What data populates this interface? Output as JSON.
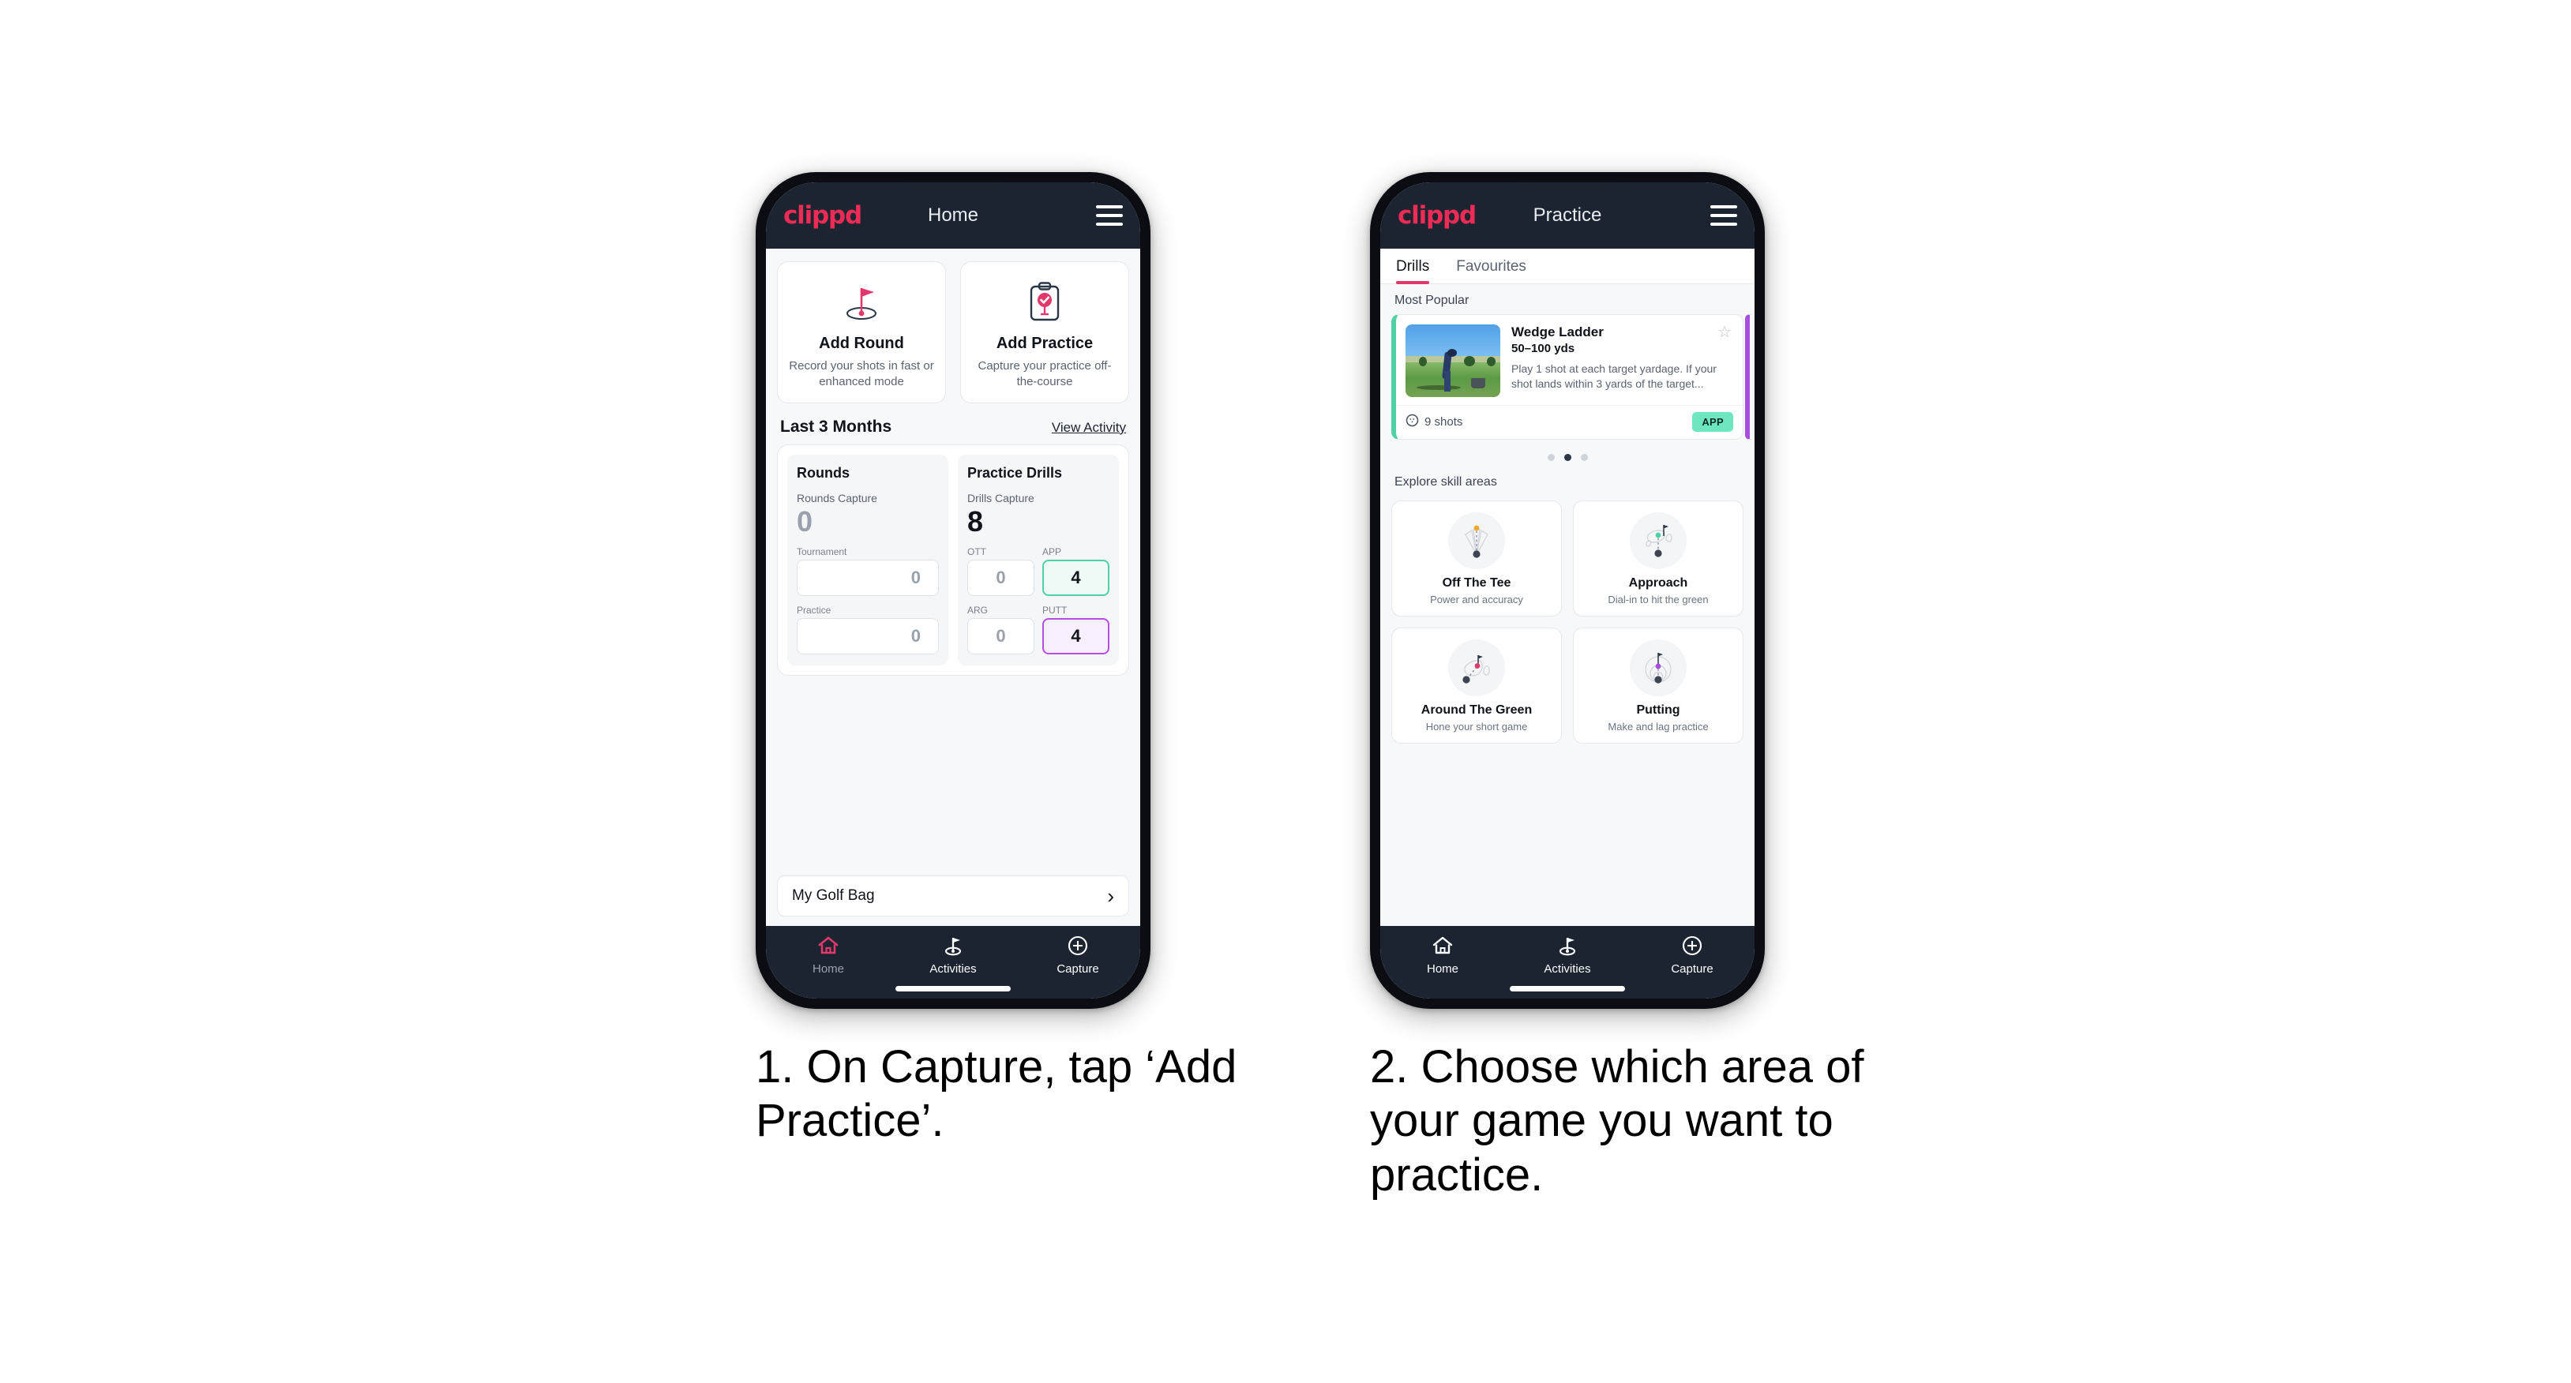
{
  "brand": "clippd",
  "phone1": {
    "appbar": {
      "title": "Home",
      "menu_icon": "hamburger-icon"
    },
    "actions": [
      {
        "icon": "golf-flag-hole-icon",
        "title": "Add Round",
        "subtitle": "Record your shots in fast or enhanced mode"
      },
      {
        "icon": "clipboard-check-tee-icon",
        "title": "Add Practice",
        "subtitle": "Capture your practice off-the-course"
      }
    ],
    "section": {
      "title": "Last 3 Months",
      "link": "View Activity"
    },
    "stats": [
      {
        "title": "Rounds",
        "capture_label": "Rounds Capture",
        "capture_value": "0",
        "fields": [
          {
            "label": "Tournament",
            "value": "0",
            "style": "plain"
          },
          {
            "label": "Practice",
            "value": "0",
            "style": "plain"
          }
        ]
      },
      {
        "title": "Practice Drills",
        "capture_label": "Drills Capture",
        "capture_value": "8",
        "fields": [
          {
            "label": "OTT",
            "value": "0",
            "style": "plain"
          },
          {
            "label": "APP",
            "value": "4",
            "style": "app"
          },
          {
            "label": "ARG",
            "value": "0",
            "style": "plain"
          },
          {
            "label": "PUTT",
            "value": "4",
            "style": "putt"
          }
        ]
      }
    ],
    "golf_bag": {
      "label": "My Golf Bag",
      "chevron": "chevron-right-icon"
    },
    "nav": [
      {
        "label": "Home",
        "icon": "home-icon",
        "active": true
      },
      {
        "label": "Activities",
        "icon": "golf-flag-icon",
        "active": false
      },
      {
        "label": "Capture",
        "icon": "plus-circle-icon",
        "active": false
      }
    ]
  },
  "phone2": {
    "appbar": {
      "title": "Practice",
      "menu_icon": "hamburger-icon"
    },
    "tabs": [
      {
        "label": "Drills",
        "active": true
      },
      {
        "label": "Favourites",
        "active": false
      }
    ],
    "most_popular_label": "Most Popular",
    "drill": {
      "title": "Wedge Ladder",
      "yardage": "50–100 yds",
      "description": "Play 1 shot at each target yardage. If your shot lands within 3 yards of the target...",
      "shots": "9 shots",
      "shots_icon": "golf-ball-icon",
      "badge": "APP",
      "favourite_icon": "star-outline-icon",
      "thumbnail": "golfer-on-range-photo",
      "accent_color": "#4fd1a5",
      "next_accent_color": "#a64ee0"
    },
    "carousel_dots": {
      "count": 3,
      "active_index": 1
    },
    "explore_label": "Explore skill areas",
    "skills": [
      {
        "title": "Off The Tee",
        "subtitle": "Power and accuracy",
        "icon": "tee-shot-dispersion-icon",
        "dot_color": "#f0a92b"
      },
      {
        "title": "Approach",
        "subtitle": "Dial-in to hit the green",
        "icon": "approach-green-icon",
        "dot_color": "#4fd1a5"
      },
      {
        "title": "Around The Green",
        "subtitle": "Hone your short game",
        "icon": "around-green-icon",
        "dot_color": "#e3386b"
      },
      {
        "title": "Putting",
        "subtitle": "Make and lag practice",
        "icon": "putting-rings-icon",
        "dot_color": "#a64ee0"
      }
    ],
    "nav": [
      {
        "label": "Home",
        "icon": "home-icon",
        "active": false
      },
      {
        "label": "Activities",
        "icon": "golf-flag-icon",
        "active": false
      },
      {
        "label": "Capture",
        "icon": "plus-circle-icon",
        "active": false
      }
    ]
  },
  "captions": {
    "step1": "1. On Capture, tap ‘Add Practice’.",
    "step2": "2. Choose which area of your game you want to practice."
  },
  "colors": {
    "brand_pink": "#ee2b55",
    "nav_dark": "#1b2430",
    "app_green": "#4fd1a5",
    "putt_purple": "#b34fe0",
    "badge_green": "#6ee7c0",
    "page_bg": "#f7f8fa"
  }
}
